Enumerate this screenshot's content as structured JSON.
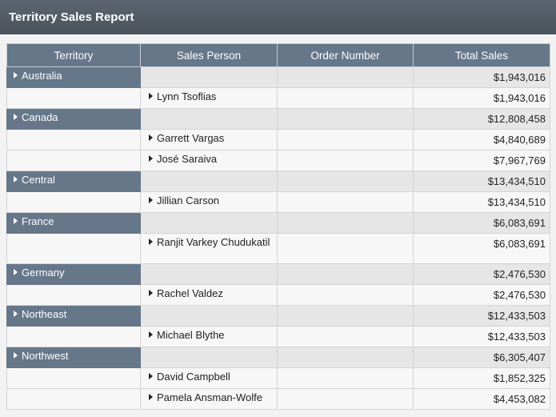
{
  "report": {
    "title": "Territory Sales Report"
  },
  "columns": [
    "Territory",
    "Sales Person",
    "Order Number",
    "Total Sales"
  ],
  "groups": [
    {
      "territory": "Australia",
      "total": "$1,943,016",
      "people": [
        {
          "name": "Lynn Tsoflias",
          "total": "$1,943,016"
        }
      ]
    },
    {
      "territory": "Canada",
      "total": "$12,808,458",
      "people": [
        {
          "name": "Garrett Vargas",
          "total": "$4,840,689"
        },
        {
          "name": "José Saraiva",
          "total": "$7,967,769"
        }
      ]
    },
    {
      "territory": "Central",
      "total": "$13,434,510",
      "people": [
        {
          "name": "Jillian Carson",
          "total": "$13,434,510"
        }
      ]
    },
    {
      "territory": "France",
      "total": "$6,083,691",
      "people": [
        {
          "name": "Ranjit Varkey Chudukatil",
          "total": "$6,083,691"
        }
      ]
    },
    {
      "territory": "Germany",
      "total": "$2,476,530",
      "people": [
        {
          "name": "Rachel Valdez",
          "total": "$2,476,530"
        }
      ]
    },
    {
      "territory": "Northeast",
      "total": "$12,433,503",
      "people": [
        {
          "name": "Michael Blythe",
          "total": "$12,433,503"
        }
      ]
    },
    {
      "territory": "Northwest",
      "total": "$6,305,407",
      "people": [
        {
          "name": "David Campbell",
          "total": "$1,852,325"
        },
        {
          "name": "Pamela Ansman-Wolfe",
          "total": "$4,453,082"
        }
      ]
    }
  ]
}
